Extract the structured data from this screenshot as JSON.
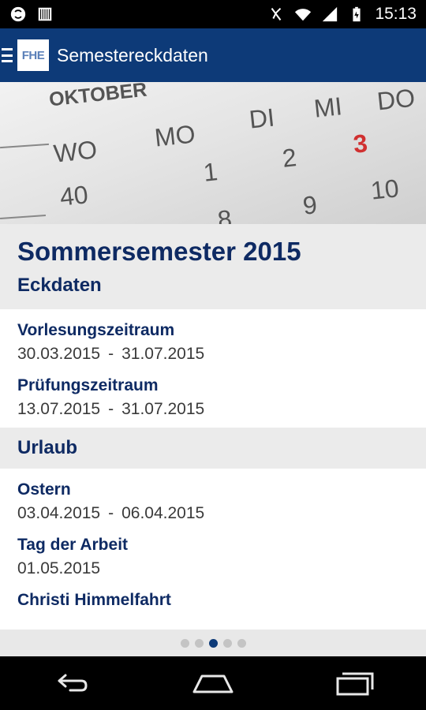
{
  "status_bar": {
    "time": "15:13",
    "icons": [
      "sync-icon",
      "barcode-icon",
      "mute-icon",
      "wifi-icon",
      "signal-icon",
      "battery-icon"
    ]
  },
  "app_bar": {
    "logo_text": "FHE",
    "title": "Semestereckdaten",
    "color": "#0d3a78"
  },
  "hero": {
    "month": "OKTOBER",
    "days": [
      "WO",
      "MO",
      "DI",
      "MI",
      "DO"
    ],
    "numbers": [
      "40",
      "1",
      "2",
      "3",
      "8",
      "9",
      "10"
    ]
  },
  "semester": {
    "title": "Sommersemester 2015",
    "sections": [
      {
        "title": "Eckdaten",
        "entries": [
          {
            "label": "Vorlesungszeitraum",
            "start": "30.03.2015",
            "end": "31.07.2015"
          },
          {
            "label": "Prüfungszeitraum",
            "start": "13.07.2015",
            "end": "31.07.2015"
          }
        ]
      },
      {
        "title": "Urlaub",
        "entries": [
          {
            "label": "Ostern",
            "start": "03.04.2015",
            "end": "06.04.2015"
          },
          {
            "label": "Tag der Arbeit",
            "start": "01.05.2015"
          },
          {
            "label": "Christi Himmelfahrt"
          }
        ]
      }
    ],
    "date_separator": "-"
  },
  "pager": {
    "total": 5,
    "active_index": 2
  },
  "nav_bar": {
    "buttons": [
      "back-icon",
      "home-icon",
      "recent-apps-icon"
    ]
  }
}
